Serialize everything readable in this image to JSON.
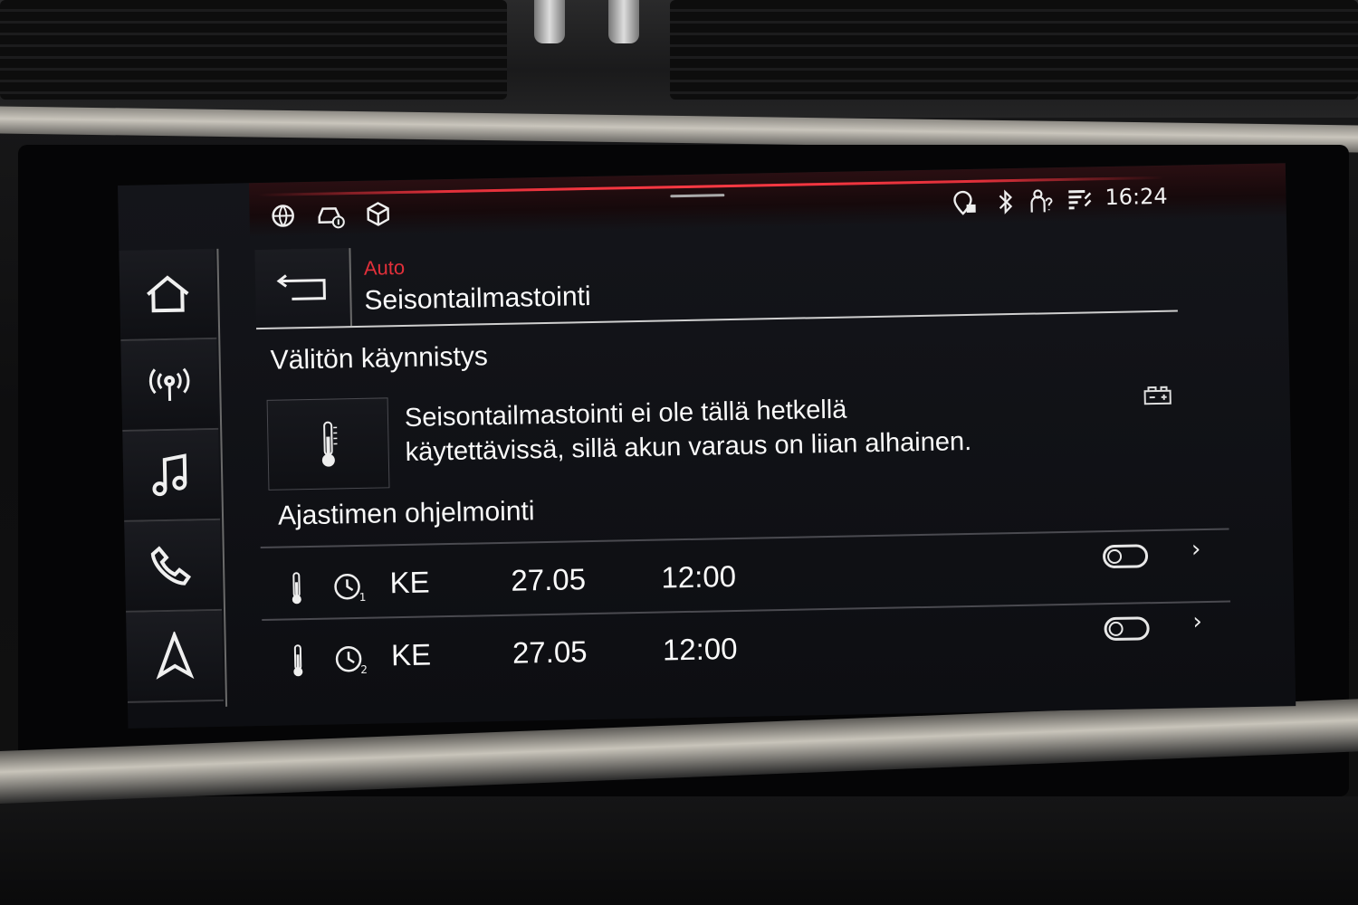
{
  "status_bar": {
    "left_icons": [
      "globe-sync-icon",
      "car-info-icon",
      "package-icon"
    ],
    "right_icons": [
      "location-lock-icon",
      "bluetooth-icon",
      "person-question-icon",
      "network-signal-icon"
    ],
    "time": "16:24"
  },
  "sidebar": {
    "items": [
      {
        "icon": "home-icon"
      },
      {
        "icon": "radio-antenna-icon"
      },
      {
        "icon": "music-note-icon"
      },
      {
        "icon": "phone-icon"
      },
      {
        "icon": "navigation-arrow-icon"
      }
    ]
  },
  "header": {
    "breadcrumb": "Auto",
    "title": "Seisontailmastointi"
  },
  "immediate_start": {
    "heading": "Välitön käynnistys",
    "message_line1": "Seisontailmastointi ei ole tällä hetkellä",
    "message_line2": "käytettävissä, sillä akun varaus on liian alhainen."
  },
  "timer_programming": {
    "heading": "Ajastimen ohjelmointi",
    "rows": [
      {
        "timer_number": "1",
        "day": "KE",
        "date": "27.05",
        "time": "12:00",
        "enabled": false
      },
      {
        "timer_number": "2",
        "day": "KE",
        "date": "27.05",
        "time": "12:00",
        "enabled": false
      }
    ]
  },
  "colors": {
    "accent_red": "#e2303a",
    "text": "#fafafa",
    "background": "#0d0e12"
  }
}
